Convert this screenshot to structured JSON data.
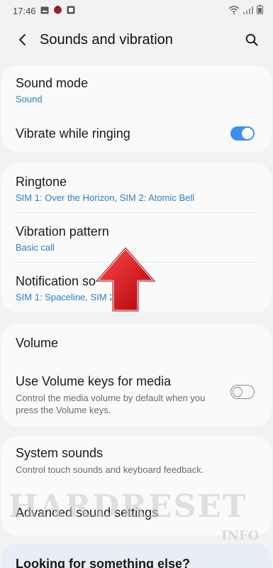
{
  "status_bar": {
    "time": "17:46"
  },
  "header": {
    "title": "Sounds and vibration"
  },
  "sound_card": {
    "sound_mode": {
      "title": "Sound mode",
      "value": "Sound"
    },
    "vibrate": {
      "title": "Vibrate while ringing",
      "state": "on"
    }
  },
  "tones_card": {
    "ringtone": {
      "title": "Ringtone",
      "value": "SIM 1: Over the Horizon, SIM 2: Atomic Bell"
    },
    "vibration_pattern": {
      "title": "Vibration pattern",
      "value": "Basic call"
    },
    "notification_sounds": {
      "title": "Notification so",
      "value": "SIM 1: Spaceline, SIM 2",
      "value_tail": "al"
    }
  },
  "volume_card": {
    "volume": {
      "title": "Volume"
    },
    "volume_keys": {
      "title": "Use Volume keys for media",
      "description": "Control the media volume by default when you press the Volume keys.",
      "state": "off"
    }
  },
  "system_card": {
    "system_sounds": {
      "title": "System sounds",
      "description": "Control touch sounds and keyboard feedback."
    },
    "advanced": {
      "title": "Advanced sound settings"
    }
  },
  "bottom_card": {
    "partial_text": "Looking for something else?"
  },
  "watermark": {
    "text": "HARDRESET",
    "sub": "INFO"
  },
  "colors": {
    "accent": "#3e8ef0",
    "link_text": "#2f7fc1",
    "arrow_red": "#d8121b"
  },
  "icons": {
    "back": "chevron-left-icon",
    "search": "search-icon",
    "wifi": "wifi-icon",
    "signal": "signal-icon",
    "battery": "battery-icon",
    "gallery": "gallery-icon",
    "bug": "ladybug-icon",
    "screenshot": "screenshot-icon"
  }
}
